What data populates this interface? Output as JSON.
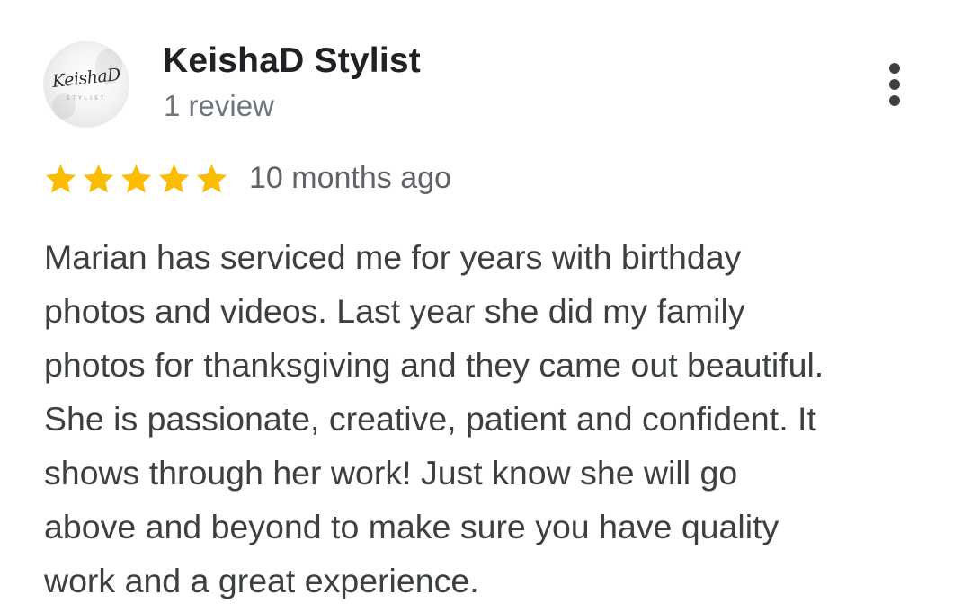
{
  "reviewer": {
    "name": "KeishaD Stylist",
    "review_count": "1 review",
    "avatar_logo": "KeishaD",
    "avatar_logo_sub": "STYLIST",
    "avatar_icon": "profile-photo-logo"
  },
  "menu": {
    "icon": "more-vert-icon"
  },
  "rating": {
    "stars": 5,
    "max_stars": 5,
    "star_color": "#fbbc04",
    "time_ago": "10 months ago"
  },
  "review": {
    "lines": [
      "Marian has serviced me for years with birthday",
      "photos and videos. Last year she did my family",
      "photos for thanksgiving and they came out beautiful.",
      "She is passionate, creative, patient and confident. It",
      "shows through her work! Just know she will go",
      "above and beyond to make sure you have quality",
      "work and a great experience."
    ]
  },
  "colors": {
    "name_text": "#202124",
    "body_text": "#3c4043",
    "secondary_text": "#70757a"
  }
}
